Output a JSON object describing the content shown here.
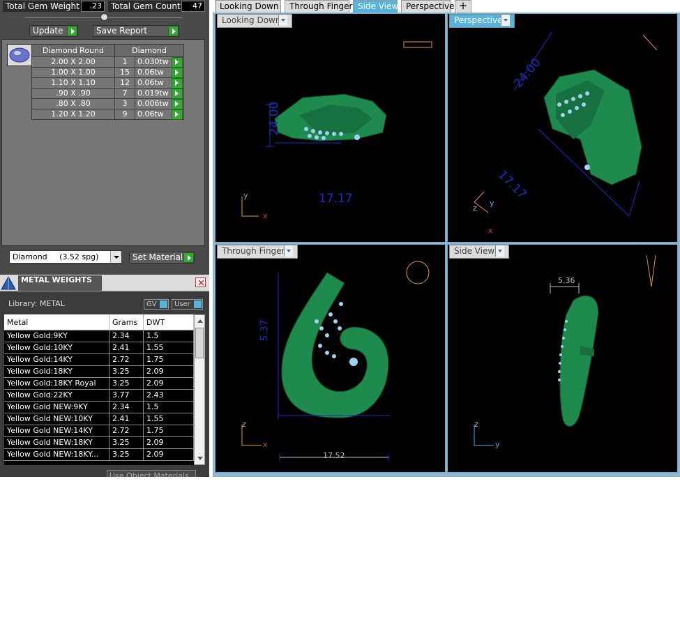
{
  "stats": {
    "gem_weight_label": "Total Gem Weight",
    "gem_weight_value": ".23",
    "gem_count_label": "Total Gem Count",
    "gem_count_value": "47"
  },
  "actions": {
    "update_label": "Update",
    "save_report_label": "Save Report"
  },
  "gem_table": {
    "col_shape": "Diamond Round",
    "col_type": "Diamond",
    "rows": [
      {
        "size": "2.00 X 2.00",
        "count": "1",
        "weight": "0.030tw"
      },
      {
        "size": "1.00 X 1.00",
        "count": "15",
        "weight": "0.06tw"
      },
      {
        "size": "1.10 X 1.10",
        "count": "12",
        "weight": "0.06tw"
      },
      {
        "size": ".90 X .90",
        "count": "7",
        "weight": "0.019tw"
      },
      {
        "size": ".80 X .80",
        "count": "3",
        "weight": "0.006tw"
      },
      {
        "size": "1.20 X 1.20",
        "count": "9",
        "weight": "0.06tw"
      }
    ]
  },
  "material": {
    "select_value": "Diamond     (3.52 spg)",
    "set_material_label": "Set Material"
  },
  "metal_weights": {
    "title": "METAL WEIGHTS",
    "library_label": "Library: METAL",
    "gv_label": "GV",
    "user_label": "User",
    "columns": [
      "Metal",
      "Grams",
      "DWT"
    ],
    "rows": [
      [
        "Yellow Gold:9KY",
        "2.34",
        "1.5"
      ],
      [
        "Yellow Gold:10KY",
        "2.41",
        "1.55"
      ],
      [
        "Yellow Gold:14KY",
        "2.72",
        "1.75"
      ],
      [
        "Yellow Gold:18KY",
        "3.25",
        "2.09"
      ],
      [
        "Yellow Gold:18KY Royal",
        "3.25",
        "2.09"
      ],
      [
        "Yellow Gold:22KY",
        "3.77",
        "2.43"
      ],
      [
        "Yellow Gold NEW:9KY",
        "2.34",
        "1.5"
      ],
      [
        "Yellow Gold NEW:10KY",
        "2.41",
        "1.55"
      ],
      [
        "Yellow Gold NEW:14KY",
        "2.72",
        "1.75"
      ],
      [
        "Yellow Gold NEW:18KY",
        "3.25",
        "2.09"
      ],
      [
        "Yellow Gold NEW:18KY...",
        "3.25",
        "2.09"
      ]
    ],
    "use_object_label": "Use Object Materials"
  },
  "tabs": [
    "Looking Down",
    "Through Finger",
    "Side View",
    "Perspective"
  ],
  "add_tab": "+",
  "viewports": {
    "looking_down": {
      "title": "Looking Down",
      "dim_a": "24.00",
      "dim_b": "17.17",
      "ax1": "y",
      "ax2": "x"
    },
    "perspective": {
      "title": "Perspective",
      "dim_a": "24.00",
      "dim_b": "17.17",
      "ax1": "z",
      "ax2": "y",
      "ax3": "x"
    },
    "through_finger": {
      "title": "Through Finger",
      "dim_a": "5.37",
      "dim_b": "17.52",
      "ax1": "z",
      "ax2": "x"
    },
    "side_view": {
      "title": "Side View",
      "dim_a": "5.36",
      "ax1": "z",
      "ax2": "y"
    }
  },
  "colors": {
    "accent": "#56b3dc",
    "model": "#1e8a4e",
    "gem": "#9fd3f0",
    "dimension": "#1c2ec0",
    "go": "#3aa53a"
  }
}
